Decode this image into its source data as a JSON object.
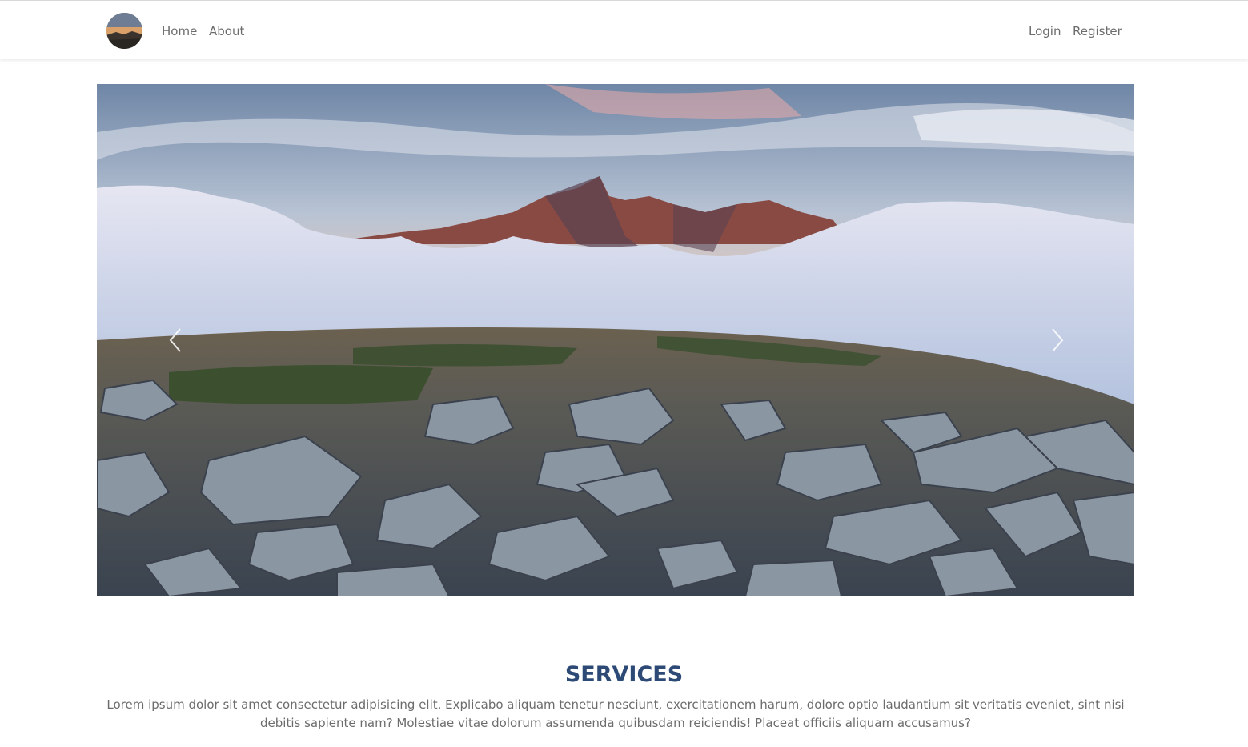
{
  "nav": {
    "logo_alt": "mountain-avatar",
    "left_links": [
      {
        "label": "Home"
      },
      {
        "label": "About"
      }
    ],
    "right_links": [
      {
        "label": "Login"
      },
      {
        "label": "Register"
      }
    ]
  },
  "carousel": {
    "slide": "mountain-peak-above-clouds",
    "prev_icon": "chevron-left-icon",
    "next_icon": "chevron-right-icon"
  },
  "services": {
    "title": "SERVICES",
    "text": "Lorem ipsum dolor sit amet consectetur adipisicing elit. Explicabo aliquam tenetur nesciunt, exercitationem harum, dolore optio laudantium sit veritatis eveniet, sint nisi debitis sapiente nam? Molestiae vitae dolorum assumenda quibusdam reiciendis! Placeat officiis aliquam accusamus?"
  },
  "colors": {
    "heading": "#2c4a75",
    "nav_text": "#6c6c6c",
    "body_text": "#6c6c6c"
  }
}
